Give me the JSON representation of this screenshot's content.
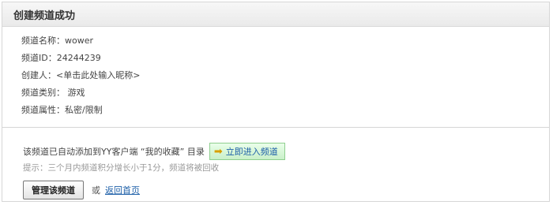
{
  "header": {
    "title": "创建频道成功"
  },
  "channel_info": [
    {
      "label": "频道名称：",
      "value": "wower"
    },
    {
      "label": "频道ID：",
      "value": "24244239"
    },
    {
      "label": "创建人：",
      "value": "<单击此处输入昵称>"
    },
    {
      "label": "频道类别：",
      "value": " 游戏"
    },
    {
      "label": "频道属性：",
      "value": "私密/限制"
    }
  ],
  "notice": {
    "text": "该频道已自动添加到YY客户端 “我的收藏” 目录",
    "enter_button_label": "立即进入频道",
    "enter_icon": "arrow-right-icon"
  },
  "tip": "提示：三个月内频道积分增长小于1分，频道将被回收",
  "actions": {
    "manage_button_label": "管理该频道",
    "or_text": "或",
    "home_link_label": "返回首页"
  }
}
